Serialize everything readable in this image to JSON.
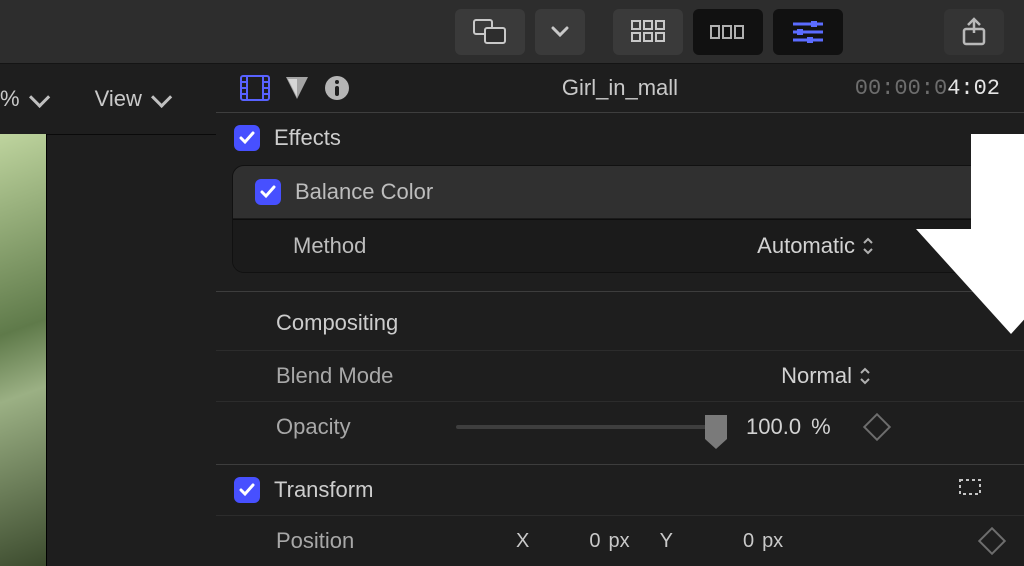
{
  "toolbar": {
    "icons": [
      "display-compare",
      "dropdown",
      "grid",
      "filmstrip",
      "sliders",
      "share"
    ]
  },
  "left": {
    "percent_label": "%",
    "view_label": "View"
  },
  "inspector": {
    "clip_title": "Girl_in_mall",
    "timecode_dim": "00:00:0",
    "timecode_hi": "4:02",
    "sections": {
      "effects": {
        "label": "Effects",
        "enabled": true
      },
      "balance_color": {
        "label": "Balance Color",
        "enabled": true,
        "method_label": "Method",
        "method_value": "Automatic"
      },
      "compositing": {
        "label": "Compositing",
        "blend_mode_label": "Blend Mode",
        "blend_mode_value": "Normal",
        "opacity_label": "Opacity",
        "opacity_value": "100.0",
        "opacity_unit": "%"
      },
      "transform": {
        "label": "Transform",
        "position_label": "Position",
        "x_label": "X",
        "x_value": "0",
        "y_label": "Y",
        "y_value": "0",
        "unit": "px"
      }
    }
  }
}
